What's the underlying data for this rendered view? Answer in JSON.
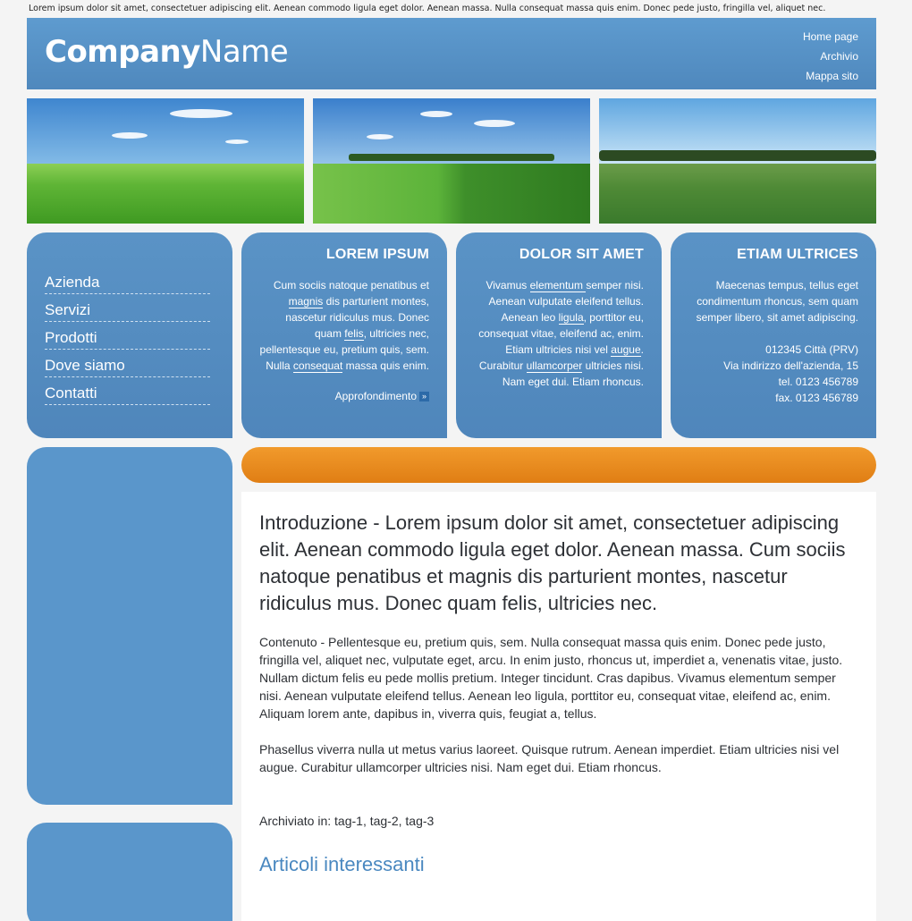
{
  "tagline": "Lorem ipsum dolor sit amet, consectetuer adipiscing elit. Aenean commodo ligula eget dolor. Aenean massa. Nulla consequat massa quis enim. Donec pede justo, fringilla vel, aliquet nec.",
  "header": {
    "logo_bold": "Company",
    "logo_light": "Name",
    "nav": [
      "Home page",
      "Archivio",
      "Mappa sito"
    ]
  },
  "sidebar": {
    "items": [
      "Azienda",
      "Servizi",
      "Prodotti",
      "Dove siamo",
      "Contatti"
    ]
  },
  "boxes": [
    {
      "title": "LOREM IPSUM",
      "parts": [
        "Cum sociis natoque penatibus et ",
        "magnis",
        " dis parturient montes, nascetur ridiculus mus. Donec quam ",
        "felis",
        ", ultricies nec, pellentesque eu, pretium quis, sem. Nulla ",
        "consequat",
        " massa quis enim."
      ],
      "more": "Approfondimento"
    },
    {
      "title": "DOLOR SIT AMET",
      "parts": [
        "Vivamus ",
        "elementum ",
        "semper nisi. Aenean vulputate eleifend tellus. Aenean leo ",
        "ligula",
        ", porttitor eu, consequat vitae, eleifend ac, enim. Etiam ultricies nisi vel ",
        "augue",
        ". Curabitur ",
        "ullamcorper",
        " ultricies nisi. Nam eget dui. Etiam rhoncus."
      ]
    },
    {
      "title": "ETIAM ULTRICES",
      "text": "Maecenas tempus, tellus eget condimentum rhoncus, sem quam semper libero, sit amet adipiscing.",
      "address": [
        "012345 Città (PRV)",
        "Via indirizzo dell'azienda, 15",
        "tel. 0123 456789",
        "fax. 0123 456789"
      ]
    }
  ],
  "content": {
    "intro": "Introduzione - Lorem ipsum dolor sit amet, consectetuer adipiscing elit. Aenean commodo ligula eget dolor. Aenean massa. Cum sociis natoque penatibus et magnis dis parturient montes, nascetur ridiculus mus. Donec quam felis, ultricies nec.",
    "para1": "Contenuto - Pellentesque eu, pretium quis, sem. Nulla consequat massa quis enim. Donec pede justo, fringilla vel, aliquet nec, vulputate eget, arcu. In enim justo, rhoncus ut, imperdiet a, venenatis vitae, justo. Nullam dictum felis eu pede mollis pretium. Integer tincidunt. Cras dapibus. Vivamus elementum semper nisi. Aenean vulputate eleifend tellus. Aenean leo ligula, porttitor eu, consequat vitae, eleifend ac, enim. Aliquam lorem ante, dapibus in, viverra quis, feugiat a, tellus.",
    "para2": "Phasellus viverra nulla ut metus varius laoreet. Quisque rutrum. Aenean imperdiet. Etiam ultricies nisi vel augue. Curabitur ullamcorper ultricies nisi. Nam eget dui. Etiam rhoncus.",
    "archived": "Archiviato in: tag-1, tag-2, tag-3",
    "related_title": "Articoli interessanti"
  },
  "colors": {
    "header_blue": "#5e9bcf",
    "box_blue": "#5a93c6",
    "accent_orange": "#e88a1e"
  }
}
